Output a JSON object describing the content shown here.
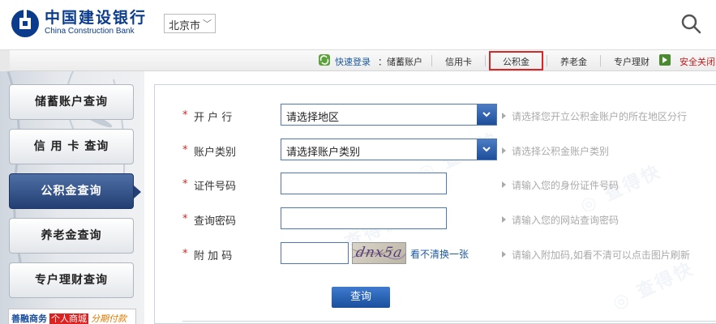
{
  "header": {
    "logo_cn": "中国建设银行",
    "logo_en": "China Construction Bank",
    "city_selected": "北京市",
    "brand_color": "#0b3c8c"
  },
  "nav": {
    "quick_login": "快速登录",
    "savings_account": "：储蓄账户",
    "credit_card": "信用卡",
    "housing_fund": "公积金",
    "pension": "养老金",
    "wealth": "专户理财",
    "safe_exit": "安全关闭",
    "highlight_color": "#d62828"
  },
  "sidebar": {
    "items": [
      {
        "label": "储蓄账户查询"
      },
      {
        "label": "信 用 卡 查询"
      },
      {
        "label": "公积金查询",
        "active": true
      },
      {
        "label": "养老金查询"
      },
      {
        "label": "专户理财查询"
      }
    ],
    "promo": {
      "a": "善融商务",
      "b": "个人商城",
      "c": "分期付款"
    },
    "active_color": "#233f73"
  },
  "form": {
    "fields": [
      {
        "label": "开 户 行",
        "type": "select",
        "value": "请选择地区",
        "hint": "请选择您开立公积金账户的所在地区分行"
      },
      {
        "label": "账户类别",
        "type": "select",
        "value": "请选择账户类别",
        "hint": "请选择公积金账户类别"
      },
      {
        "label": "证件号码",
        "type": "input",
        "value": "",
        "hint": "请输入您的身份证件号码"
      },
      {
        "label": "查询密码",
        "type": "input",
        "value": "",
        "hint": "请输入您的网站查询密码"
      },
      {
        "label": "附 加 码",
        "type": "captcha",
        "value": "",
        "hint": "请输入附加码,如看不清可以点击图片刷新"
      }
    ],
    "captcha_text": "dnx5a",
    "refresh_link": "看不清换一张",
    "submit": "查询"
  }
}
